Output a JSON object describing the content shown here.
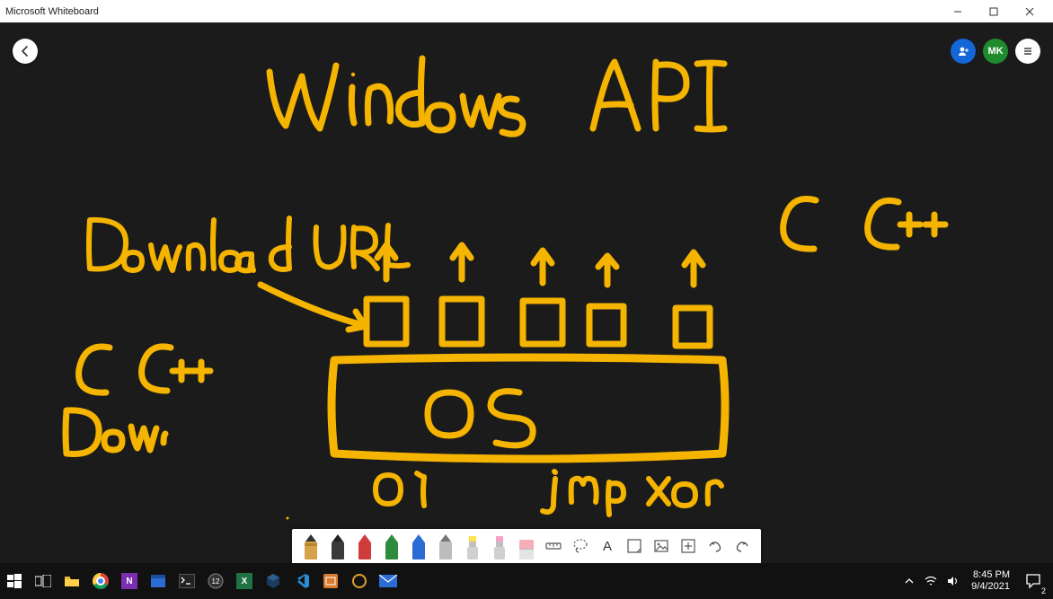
{
  "window": {
    "title": "Microsoft Whiteboard"
  },
  "header": {
    "avatar_initials": "MK"
  },
  "canvas": {
    "ink_color": "#f5b400",
    "annotations": {
      "title": "Windows API",
      "download_url": "Download URL",
      "left_c": "C",
      "left_cpp": "C++",
      "left_down": "Down",
      "right_c": "C",
      "right_cpp": "C++",
      "os": "OS",
      "zero_one": "01",
      "jmp": "jmp",
      "xor": "xor"
    }
  },
  "toolbar": {
    "pens": [
      {
        "color": "#d6a24a",
        "tip": "#333"
      },
      {
        "color": "#222",
        "tip": "#222"
      },
      {
        "color": "#d03b3b",
        "tip": "#d03b3b"
      },
      {
        "color": "#2e8b3d",
        "tip": "#2e8b3d"
      },
      {
        "color": "#2b6cd4",
        "tip": "#2b6cd4"
      },
      {
        "color": "#9b9b9b",
        "tip": "#777"
      }
    ],
    "highlighters": [
      {
        "tip_color": "#ffe24a"
      },
      {
        "tip_color": "#f7a1c4"
      }
    ],
    "text_glyph": "A"
  },
  "system": {
    "time": "8:45 PM",
    "date": "9/4/2021",
    "notification_count": "2",
    "taskbar_badge": "12"
  }
}
